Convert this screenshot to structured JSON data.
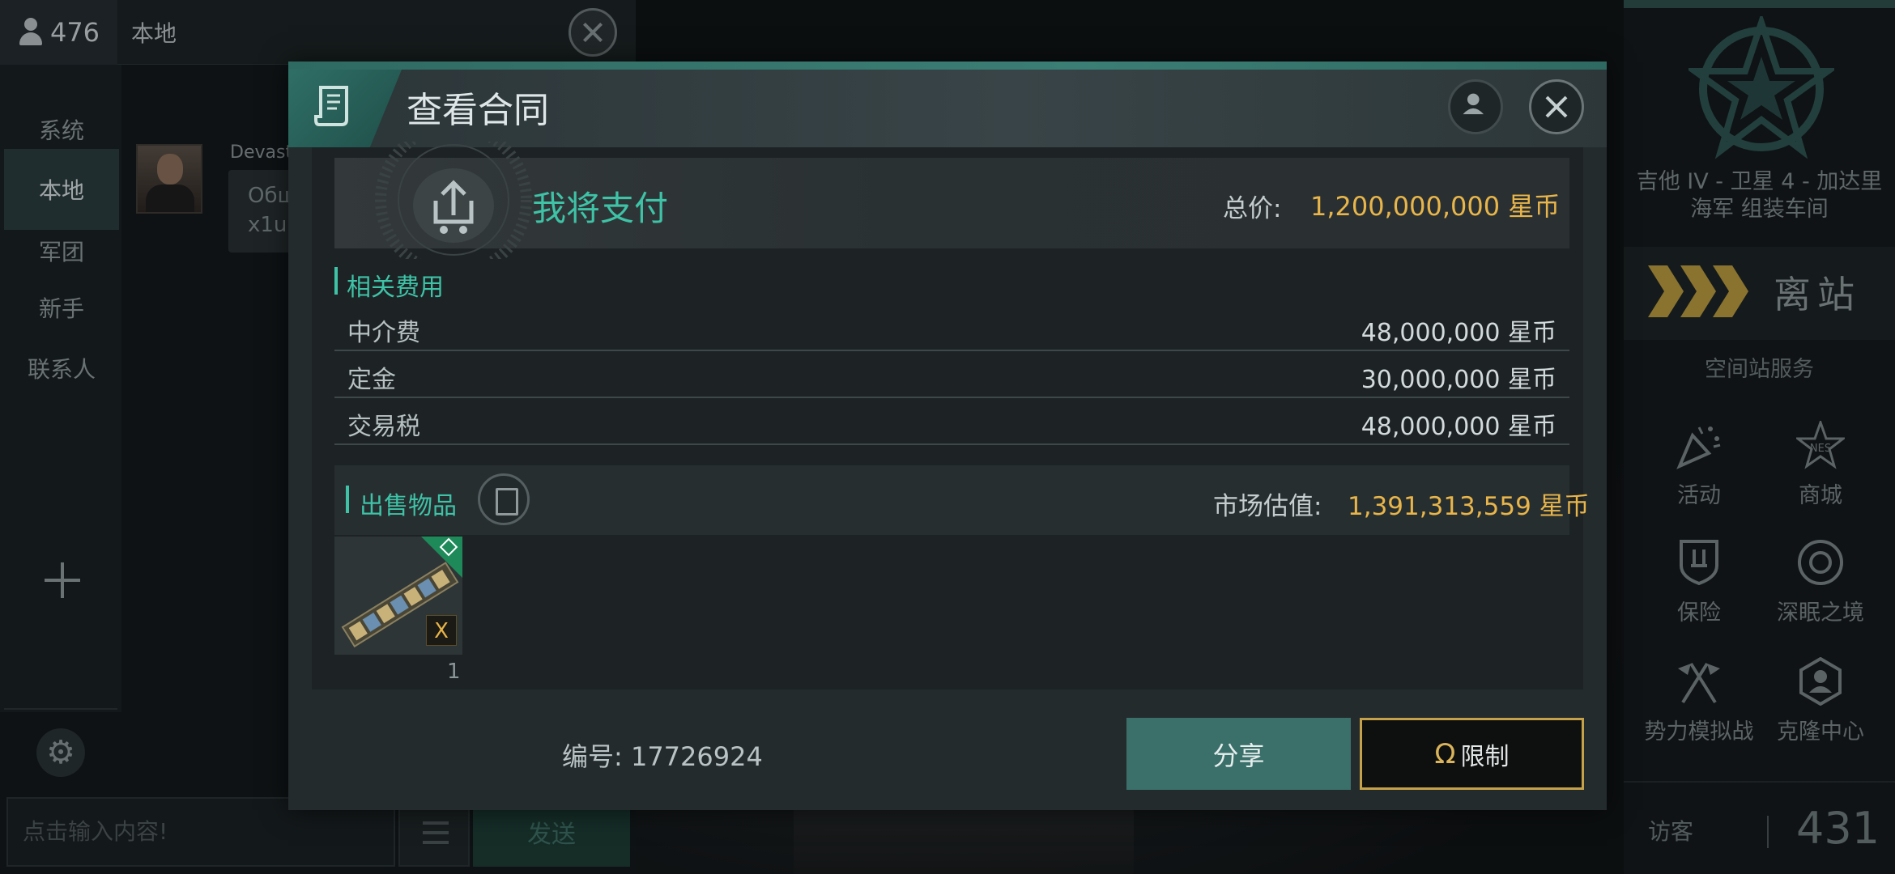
{
  "chat": {
    "player_count": "476",
    "channel_title": "本地",
    "tabs": [
      "系统",
      "本地",
      "军团",
      "新手",
      "联系人"
    ],
    "message_sender": "Devast",
    "message_lines": [
      "Обш",
      "x1u"
    ],
    "input_placeholder": "点击输入内容!",
    "send_label": "发送"
  },
  "station": {
    "location_line1": "吉他 IV - 卫星 4 - 加达里",
    "location_line2": "海军 组装车间",
    "undock_label": "离站",
    "services_title": "空间站服务",
    "services": [
      {
        "label": "活动",
        "icon": "party-popper-icon"
      },
      {
        "label": "商城",
        "icon": "neo-store-icon"
      },
      {
        "label": "保险",
        "icon": "insurance-shield-icon"
      },
      {
        "label": "深眠之境",
        "icon": "deep-sleep-icon"
      },
      {
        "label": "势力模拟战",
        "icon": "crossed-flags-icon"
      },
      {
        "label": "克隆中心",
        "icon": "clone-center-icon"
      }
    ],
    "visitor_label": "访客",
    "visitor_count": "431"
  },
  "contract": {
    "title": "查看合同",
    "pay_label": "我将支付",
    "total_label": "总价:",
    "total_value": "1,200,000,000 星币",
    "fees_title": "相关费用",
    "fees": [
      {
        "name": "中介费",
        "value": "48,000,000 星币"
      },
      {
        "name": "定金",
        "value": "30,000,000 星币"
      },
      {
        "name": "交易税",
        "value": "48,000,000 星币"
      }
    ],
    "items_title": "出售物品",
    "market_label": "市场估值:",
    "market_value": "1,391,313,559 星币",
    "item": {
      "badge": "X",
      "quantity": "1"
    },
    "number_label": "编号: 17726924",
    "share_label": "分享",
    "limit_symbol": "Ω",
    "limit_label": "限制"
  },
  "colors": {
    "accent": "#3ec3a7",
    "gold": "#e8b54a",
    "header_accent": "#2f6a62"
  }
}
